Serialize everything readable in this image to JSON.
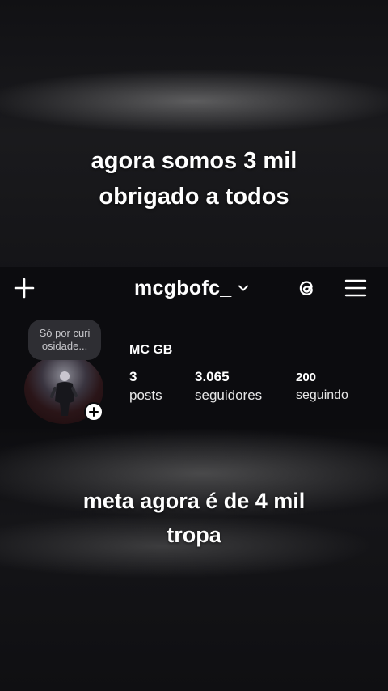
{
  "captions": {
    "top_line1": "agora somos 3 mil",
    "top_line2": "obrigado a todos",
    "bottom_line1": "meta agora é de 4 mil",
    "bottom_line2": "tropa"
  },
  "header": {
    "username": "mcgbofc_",
    "icons": [
      "plus-icon",
      "chevron-down-icon",
      "threads-icon",
      "menu-icon"
    ]
  },
  "profile": {
    "note_line1": "Só por curi",
    "note_line2": "osidade...",
    "display_name": "MC GB",
    "stats": {
      "posts": {
        "value": "3",
        "label": "posts"
      },
      "followers": {
        "value": "3.065",
        "label": "seguidores"
      },
      "following": {
        "value": "200",
        "label": "seguindo"
      }
    }
  },
  "colors": {
    "background": "#0c0c0f",
    "note_bubble": "#2e2e33",
    "text": "#ffffff"
  }
}
